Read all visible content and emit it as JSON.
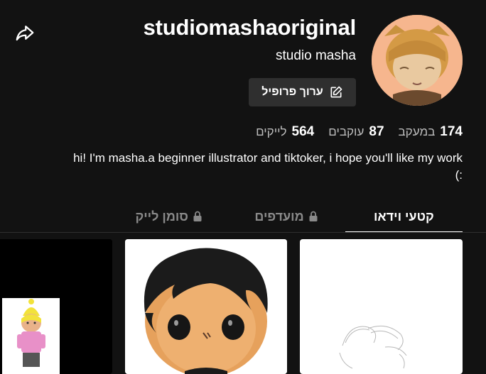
{
  "profile": {
    "username": "studiomashaoriginal",
    "nickname": "studio masha",
    "edit_profile_label": "ערוך פרופיל",
    "bio": "hi! I'm masha.a beginner illustrator and tiktoker, i hope you'll like my work :)"
  },
  "stats": [
    {
      "value": "174",
      "label": "במעקב"
    },
    {
      "value": "87",
      "label": "עוקבים"
    },
    {
      "value": "564",
      "label": "לייקים"
    }
  ],
  "tabs": [
    {
      "label": "קטעי וידאו",
      "active": true,
      "locked": false
    },
    {
      "label": "מועדפים",
      "active": false,
      "locked": true
    },
    {
      "label": "סומן לייק",
      "active": false,
      "locked": true
    }
  ],
  "icons": {
    "share": "share-icon",
    "edit": "edit-icon",
    "lock": "lock-icon"
  },
  "colors": {
    "background": "#121212",
    "button": "#2f2f2f",
    "muted_text": "#8a8a8a",
    "avatar_bg": "#f4b48d"
  }
}
